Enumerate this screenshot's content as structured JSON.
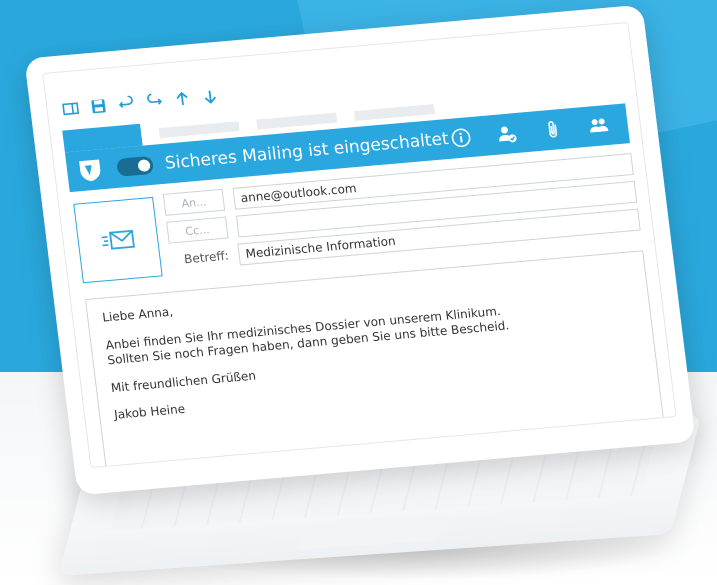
{
  "banner": {
    "text": "Sicheres Mailing ist eingeschaltet",
    "toggle_on": true,
    "icons": [
      "info-icon",
      "user-verified-icon",
      "paperclip-icon",
      "users-icon"
    ]
  },
  "toolbar": {
    "icons": [
      "window-icon",
      "save-icon",
      "undo-icon",
      "redo-icon",
      "arrow-up-icon",
      "arrow-down-icon"
    ]
  },
  "form": {
    "to_button": "An...",
    "to_value": "anne@outlook.com",
    "cc_button": "Cc...",
    "cc_value": "",
    "subject_label": "Betreff:",
    "subject_value": "Medizinische Information"
  },
  "message": {
    "greeting": "Liebe Anna,",
    "line1": "Anbei finden Sie Ihr medizinisches Dossier von unserem Klinikum.",
    "line2": "Sollten Sie noch Fragen haben, dann geben Sie uns bitte Bescheid.",
    "closing": "Mit freundlichen Grüßen",
    "signature": "Jakob Heine"
  },
  "colors": {
    "accent": "#29a7de",
    "background": "#2aa8dd"
  }
}
